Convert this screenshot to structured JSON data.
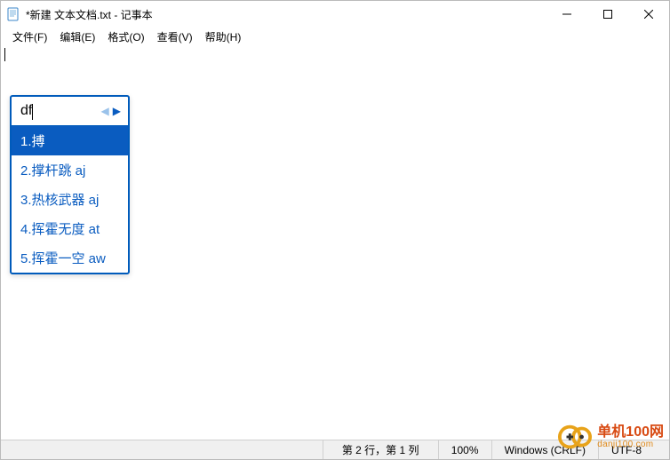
{
  "titlebar": {
    "title": "*新建 文本文档.txt - 记事本"
  },
  "menu": {
    "file": "文件(F)",
    "edit": "编辑(E)",
    "format": "格式(O)",
    "view": "查看(V)",
    "help": "帮助(H)"
  },
  "ime": {
    "typed": "df",
    "candidates": [
      {
        "text": "1.搏",
        "selected": true
      },
      {
        "text": "2.撑杆跳 aj",
        "selected": false
      },
      {
        "text": "3.热核武器 aj",
        "selected": false
      },
      {
        "text": "4.挥霍无度 at",
        "selected": false
      },
      {
        "text": "5.挥霍一空 aw",
        "selected": false
      }
    ]
  },
  "status": {
    "position": "第 2 行，第 1 列",
    "zoom": "100%",
    "eol": "Windows (CRLF)",
    "encoding": "UTF-8"
  },
  "watermark": {
    "name_cn": "单机100网",
    "url": "danji100.com"
  }
}
